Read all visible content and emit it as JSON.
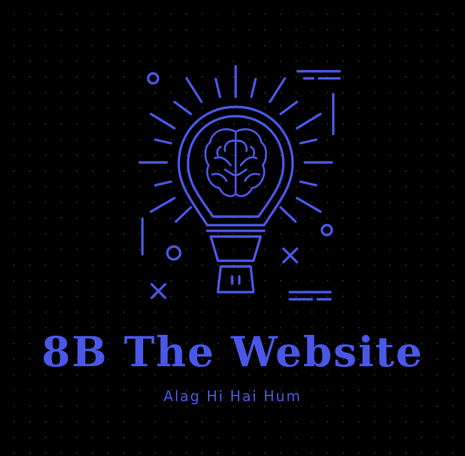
{
  "brand": {
    "title": "8B The Website",
    "tagline": "Alag Hi Hai Hum"
  },
  "logo": {
    "icon": "lightbulb-brain-icon",
    "accent_color": "#4a57e8",
    "background_color": "#000000"
  }
}
